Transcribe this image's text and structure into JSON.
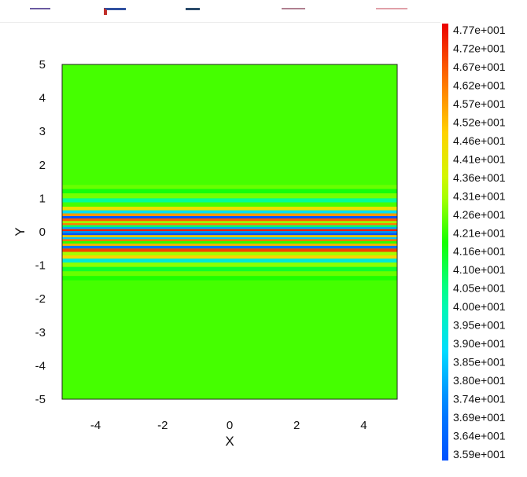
{
  "chart_data": {
    "type": "heatmap",
    "title": "",
    "xlabel": "X",
    "ylabel": "Y",
    "xlim": [
      -5,
      5
    ],
    "ylim": [
      -5,
      5
    ],
    "x_ticks": [
      -4,
      -2,
      0,
      2,
      4
    ],
    "y_ticks": [
      5,
      4,
      3,
      2,
      1,
      0,
      -1,
      -2,
      -3,
      -4,
      -5
    ],
    "grid": false,
    "legend": "right",
    "colorbar": {
      "min": 35.9,
      "max": 47.7,
      "labels": [
        "4.77e+001",
        "4.72e+001",
        "4.67e+001",
        "4.62e+001",
        "4.57e+001",
        "4.52e+001",
        "4.46e+001",
        "4.41e+001",
        "4.36e+001",
        "4.31e+001",
        "4.26e+001",
        "4.21e+001",
        "4.16e+001",
        "4.10e+001",
        "4.05e+001",
        "4.00e+001",
        "3.95e+001",
        "3.90e+001",
        "3.85e+001",
        "3.80e+001",
        "3.74e+001",
        "3.69e+001",
        "3.64e+001",
        "3.59e+001"
      ]
    },
    "background_value": 42.2,
    "bands": [
      {
        "y0": 1.4,
        "y1": 1.28,
        "value": 42.5
      },
      {
        "y0": 1.28,
        "y1": 1.15,
        "value": 41.7
      },
      {
        "y0": 1.15,
        "y1": 1.0,
        "value": 42.6
      },
      {
        "y0": 1.0,
        "y1": 0.88,
        "value": 40.4
      },
      {
        "y0": 0.88,
        "y1": 0.75,
        "value": 42.2
      },
      {
        "y0": 0.75,
        "y1": 0.64,
        "value": 44.3
      },
      {
        "y0": 0.64,
        "y1": 0.55,
        "value": 39.0
      },
      {
        "y0": 0.55,
        "y1": 0.47,
        "value": 45.6
      },
      {
        "y0": 0.47,
        "y1": 0.4,
        "value": 36.0
      },
      {
        "y0": 0.4,
        "y1": 0.32,
        "value": 46.5
      },
      {
        "y0": 0.32,
        "y1": 0.26,
        "value": 43.0
      },
      {
        "y0": 0.26,
        "y1": 0.2,
        "value": 46.0
      },
      {
        "y0": 0.2,
        "y1": 0.14,
        "value": 40.8
      },
      {
        "y0": 0.14,
        "y1": 0.08,
        "value": 38.0
      },
      {
        "y0": 0.08,
        "y1": 0.02,
        "value": 47.3
      },
      {
        "y0": 0.02,
        "y1": -0.04,
        "value": 37.5
      },
      {
        "y0": -0.04,
        "y1": -0.1,
        "value": 35.9
      },
      {
        "y0": -0.1,
        "y1": -0.16,
        "value": 45.0
      },
      {
        "y0": -0.16,
        "y1": -0.22,
        "value": 38.5
      },
      {
        "y0": -0.22,
        "y1": -0.28,
        "value": 46.2
      },
      {
        "y0": -0.28,
        "y1": -0.35,
        "value": 42.0
      },
      {
        "y0": -0.35,
        "y1": -0.42,
        "value": 45.2
      },
      {
        "y0": -0.42,
        "y1": -0.5,
        "value": 37.0
      },
      {
        "y0": -0.5,
        "y1": -0.6,
        "value": 46.8
      },
      {
        "y0": -0.6,
        "y1": -0.7,
        "value": 43.0
      },
      {
        "y0": -0.7,
        "y1": -0.8,
        "value": 44.6
      },
      {
        "y0": -0.8,
        "y1": -0.92,
        "value": 39.5
      },
      {
        "y0": -0.92,
        "y1": -1.05,
        "value": 42.8
      },
      {
        "y0": -1.05,
        "y1": -1.18,
        "value": 41.4
      },
      {
        "y0": -1.18,
        "y1": -1.32,
        "value": 42.5
      },
      {
        "y0": -1.32,
        "y1": -1.45,
        "value": 41.9
      }
    ]
  },
  "toolbar": {
    "glyph_colors": [
      "#5a4a8a",
      "#c0302a",
      "#2a4a8a",
      "#2a5a6a",
      "#b04050",
      "#c0302a"
    ]
  }
}
